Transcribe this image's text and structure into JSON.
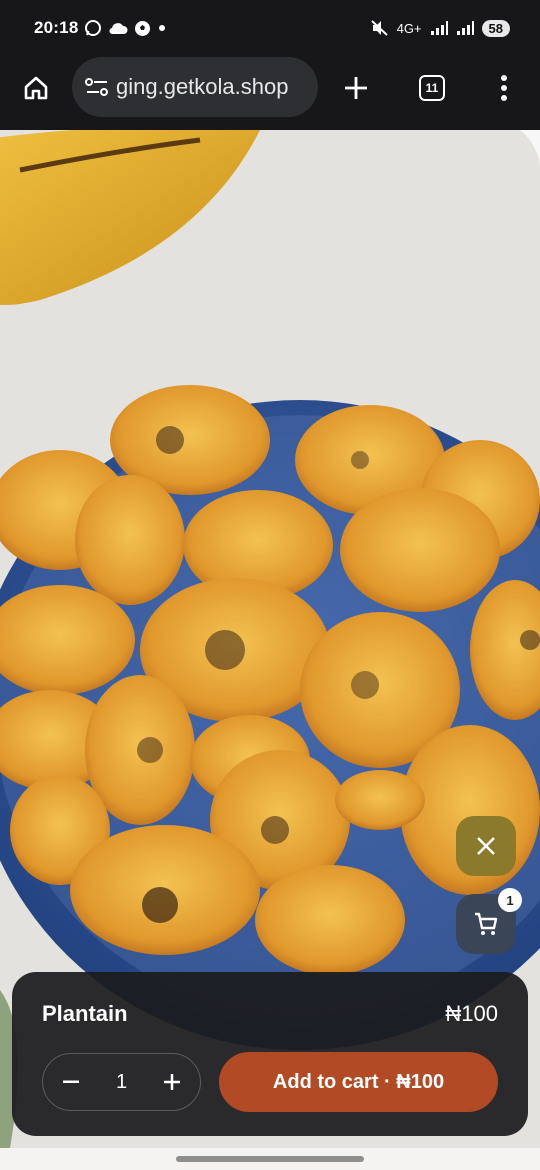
{
  "status_bar": {
    "time": "20:18",
    "network": "4G+",
    "battery": "58",
    "icons": [
      "whatsapp-icon",
      "cloud-icon",
      "football-icon",
      "dot-icon",
      "mute-icon",
      "signal-icon",
      "signal-icon",
      "battery-icon"
    ]
  },
  "browser": {
    "url": "ging.getkola.shop",
    "tab_count": "11",
    "icons": [
      "home-icon",
      "site-settings-icon",
      "new-tab-icon",
      "tab-switcher-icon",
      "more-menu-icon"
    ]
  },
  "carousel": {
    "dots": 2,
    "active_index": 0
  },
  "cart": {
    "badge_count": "1"
  },
  "product": {
    "name": "Plantain",
    "price": "₦100",
    "quantity": "1",
    "add_to_cart_label": "Add to cart · ₦100"
  },
  "colors": {
    "add_to_cart": "#b24a25",
    "close_fab": "#8b7a2c",
    "cart_fab": "#3a4658"
  }
}
